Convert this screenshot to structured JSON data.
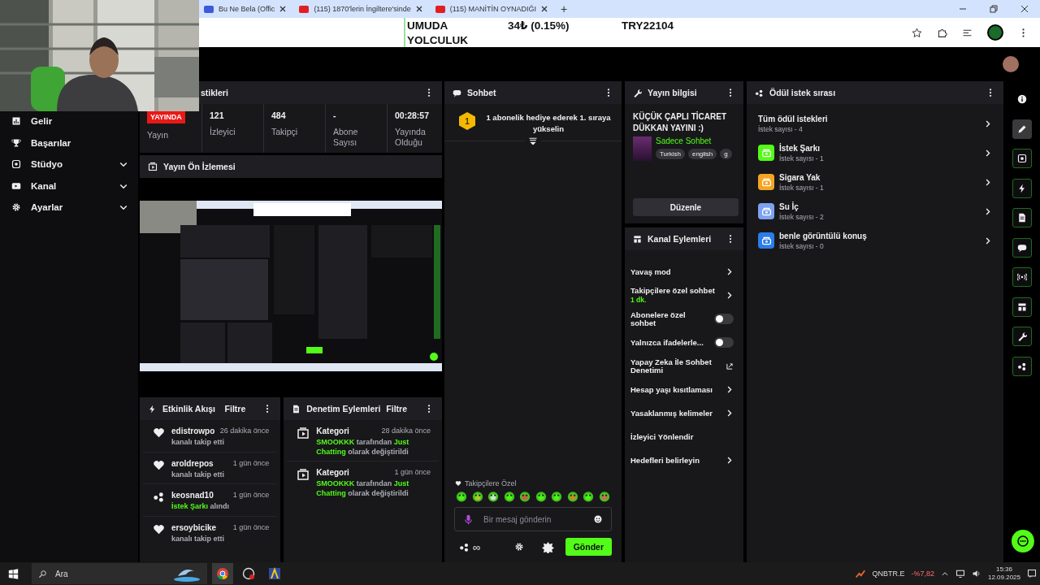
{
  "browser": {
    "tabs": [
      {
        "title": "Bu Ne Bela (Offic",
        "kind": "media"
      },
      {
        "title": "(115) 1870'lerin İngiltere'sinde",
        "kind": "youtube"
      },
      {
        "title": "(115) MANİTİN OYNADIĞI",
        "kind": "youtube"
      }
    ],
    "new_tab": "+"
  },
  "ticker": {
    "name_lines": [
      "UMUDA",
      "YOLCULUK"
    ],
    "change": "34₺ (0.15%)",
    "price": "TRY22104"
  },
  "sidebar": {
    "items": [
      {
        "label": "Gelir",
        "kind": "link"
      },
      {
        "label": "Başarılar",
        "kind": "link"
      },
      {
        "label": "Stüdyo",
        "kind": "group"
      },
      {
        "label": "Kanal",
        "kind": "group"
      },
      {
        "label": "Ayarlar",
        "kind": "group"
      }
    ]
  },
  "stats": {
    "title": "stikleri",
    "cells": [
      {
        "kind": "badge",
        "value": "YAYINDA",
        "label": "Yayın"
      },
      {
        "kind": "number",
        "value": "121",
        "label": "İzleyici"
      },
      {
        "kind": "number",
        "value": "484",
        "label": "Takipçi"
      },
      {
        "kind": "number",
        "value": "-",
        "label": "Abone Sayısı"
      },
      {
        "kind": "number",
        "value": "00:28:57",
        "label": "Yayında Olduğu"
      }
    ]
  },
  "preview": {
    "title": "Yayın Ön İzlemesi"
  },
  "events": {
    "title": "Etkinlik Akışı",
    "filter": "Filtre",
    "items": [
      {
        "kind": "follow",
        "user": "edistrowpo",
        "time": "26 dakika önce",
        "text": "kanalı takip etti"
      },
      {
        "kind": "follow",
        "user": "aroldrepos",
        "time": "1 gün önce",
        "text": "kanalı takip etti"
      },
      {
        "kind": "reward",
        "user": "keosnad10",
        "time": "1 gün önce",
        "text": "**İstek Şarkı** alındı"
      },
      {
        "kind": "follow",
        "user": "ersoybicike",
        "time": "1 gün önce",
        "text": "kanalı takip etti"
      }
    ]
  },
  "moderation": {
    "title": "Denetim Eylemleri",
    "filter": "Filtre",
    "items": [
      {
        "title": "Kategori",
        "time": "28 dakika önce",
        "text": "**SMOOKKK** tarafından **Just Chatting** olarak değiştirildi"
      },
      {
        "title": "Kategori",
        "time": "1 gün önce",
        "text": "**SMOOKKK** tarafından **Just Chatting** olarak değiştirildi"
      }
    ]
  },
  "chat": {
    "title": "Sohbet",
    "pinned": {
      "rank": "1",
      "text": "1 abonelik hediye ederek 1. sıraya yükselin"
    },
    "emote_label": "Takipçilere Özel",
    "input": {
      "placeholder": "Bir mesaj gönderin"
    },
    "infinity": "∞",
    "send": "Gönder"
  },
  "stream_info": {
    "title": "Yayın bilgisi",
    "stream_title": "KÜÇÜK ÇAPLI TİCARET DÜKKAN YAYINI :)",
    "category": "Sadece Sohbet",
    "tags": [
      "Turkish",
      "english",
      "g"
    ],
    "edit": "Düzenle"
  },
  "channel_actions": {
    "title": "Kanal Eylemleri",
    "items": [
      {
        "kind": "link",
        "label": "Yavaş mod"
      },
      {
        "kind": "link",
        "label": "Takipçilere özel sohbet",
        "note": "1 dk."
      },
      {
        "kind": "toggle",
        "label": "Abonelere özel sohbet",
        "on": false
      },
      {
        "kind": "toggle",
        "label": "Yalnızca ifadelerle...",
        "on": false
      },
      {
        "kind": "external",
        "label": "Yapay Zeka İle Sohbet Denetimi"
      },
      {
        "kind": "link",
        "label": "Hesap yaşı kısıtlaması"
      },
      {
        "kind": "link",
        "label": "Yasaklanmış kelimeler"
      },
      {
        "kind": "plain",
        "label": "İzleyici Yönlendir"
      },
      {
        "kind": "link",
        "label": "Hedefleri belirleyin"
      }
    ]
  },
  "rewards": {
    "title": "Ödül istek sırası",
    "all": {
      "label": "Tüm ödül istekleri",
      "count": "İstek sayısı - 4"
    },
    "items": [
      {
        "label": "İstek Şarkı",
        "count": "İstek sayısı - 1",
        "color": "#53fc18"
      },
      {
        "label": "Sigara Yak",
        "count": "İstek sayısı - 1",
        "color": "#f5a524"
      },
      {
        "label": "Su İç",
        "count": "İstek sayısı - 2",
        "color": "#7da2f0"
      },
      {
        "label": "benle görüntülü konuş",
        "count": "İstek sayısı - 0",
        "color": "#2b7de9"
      }
    ]
  },
  "rail": [
    {
      "kind": "info",
      "selected": false
    },
    {
      "kind": "pencil",
      "selected": true
    },
    {
      "kind": "target",
      "selected": false
    },
    {
      "kind": "bolt",
      "selected": false
    },
    {
      "kind": "doc",
      "selected": false
    },
    {
      "kind": "chat",
      "selected": false
    },
    {
      "kind": "signal",
      "selected": false
    },
    {
      "kind": "layout",
      "selected": false
    },
    {
      "kind": "wrench",
      "selected": false
    },
    {
      "kind": "nodes",
      "selected": false
    }
  ],
  "taskbar": {
    "search": "Ara",
    "stock": {
      "symbol": "QNBTR.E",
      "change": "-%7,82"
    },
    "time": "15:36",
    "date": "12.09.2025"
  }
}
